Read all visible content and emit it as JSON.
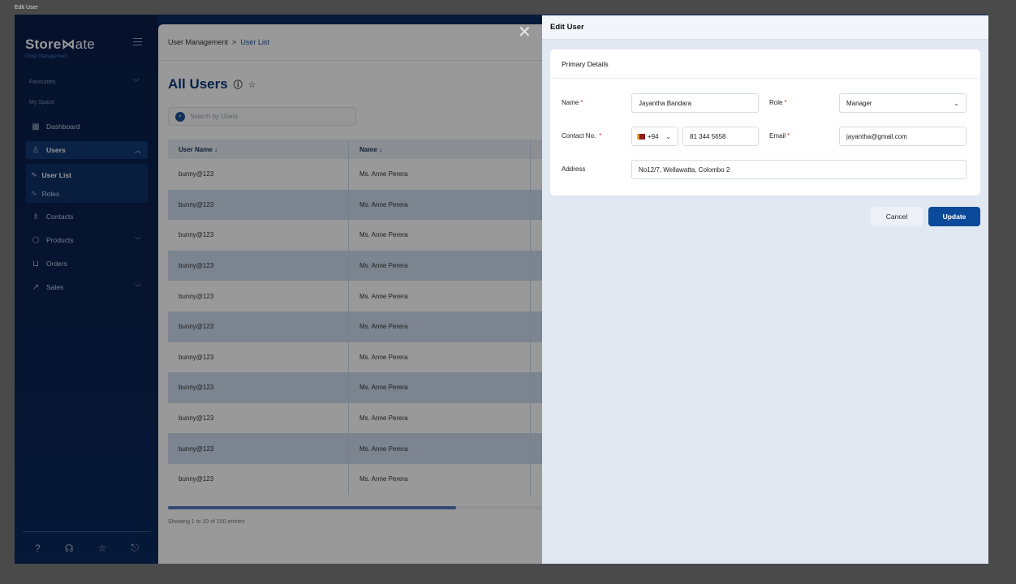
{
  "window": {
    "title": "Edit User"
  },
  "sidebar": {
    "brand": {
      "bold": "Store",
      "mark": "⋈",
      "thin": "ate"
    },
    "brand_subtitle": "Order Management",
    "sections": {
      "favourites": "Favourites",
      "my_space": "My Space"
    },
    "items": {
      "dashboard": "Dashboard",
      "users": "Users",
      "user_list": "User List",
      "roles": "Roles",
      "contacts": "Contacts",
      "products": "Products",
      "orders": "Orders",
      "sales": "Sales"
    },
    "icons": {
      "help": "?",
      "support": "☊",
      "star": "☆",
      "logout": "⎋"
    }
  },
  "main": {
    "breadcrumb": {
      "root": "User Management",
      "sep": ">",
      "current": "User List"
    },
    "title": "All Users",
    "search_placeholder": "Search by Users",
    "columns": [
      "User Name ↓",
      "Name ↓"
    ],
    "rows": [
      [
        "bunny@123",
        "Ms. Anne Perera"
      ],
      [
        "bunny@123",
        "Ms. Anne Perera"
      ],
      [
        "bunny@123",
        "Ms. Anne Perera"
      ],
      [
        "bunny@123",
        "Ms. Anne Perera"
      ],
      [
        "bunny@123",
        "Ms. Anne Perera"
      ],
      [
        "bunny@123",
        "Ms. Anne Perera"
      ],
      [
        "bunny@123",
        "Ms. Anne Perera"
      ],
      [
        "bunny@123",
        "Ms. Anne Perera"
      ],
      [
        "bunny@123",
        "Ms. Anne Perera"
      ],
      [
        "bunny@123",
        "Ms. Anne Perera"
      ],
      [
        "bunny@123",
        "Ms. Anne Perera"
      ]
    ],
    "entries": "Showing 1 to 10 of 150 entries"
  },
  "drawer": {
    "title": "Edit User",
    "card_title": "Primary Details",
    "labels": {
      "name": "Name",
      "role": "Role",
      "contact": "Contact No.",
      "email": "Email",
      "address": "Address"
    },
    "values": {
      "name": "Jayantha Bandara",
      "role": "Manager",
      "country_code": "+94",
      "phone": "81 344 5658",
      "email": "jayantha@gmail.com",
      "address": "No12/7, Wellawatta, Colombo 2"
    },
    "buttons": {
      "cancel": "Cancel",
      "update": "Update"
    }
  }
}
